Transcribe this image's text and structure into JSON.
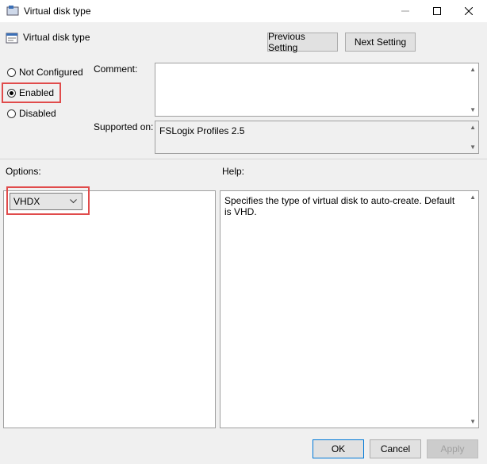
{
  "window": {
    "title": "Virtual disk type",
    "minimize_icon": "minimize-icon",
    "maximize_icon": "maximize-icon",
    "close_icon": "close-icon"
  },
  "header": {
    "title": "Virtual disk type",
    "icon": "policy-setting-icon"
  },
  "nav": {
    "previous_label": "Previous Setting",
    "next_label": "Next Setting"
  },
  "state": {
    "options": [
      {
        "label": "Not Configured",
        "checked": false
      },
      {
        "label": "Enabled",
        "checked": true
      },
      {
        "label": "Disabled",
        "checked": false
      }
    ]
  },
  "comment": {
    "label": "Comment:",
    "value": ""
  },
  "supported": {
    "label": "Supported on:",
    "value": "FSLogix Profiles 2.5"
  },
  "options_panel": {
    "label": "Options:",
    "disk_type_value": "VHDX"
  },
  "help_panel": {
    "label": "Help:",
    "text": "Specifies the type of virtual disk to auto-create. Default is VHD."
  },
  "footer": {
    "ok_label": "OK",
    "cancel_label": "Cancel",
    "apply_label": "Apply"
  },
  "colors": {
    "highlight": "#e04b4b",
    "ok_border": "#0078d7"
  }
}
